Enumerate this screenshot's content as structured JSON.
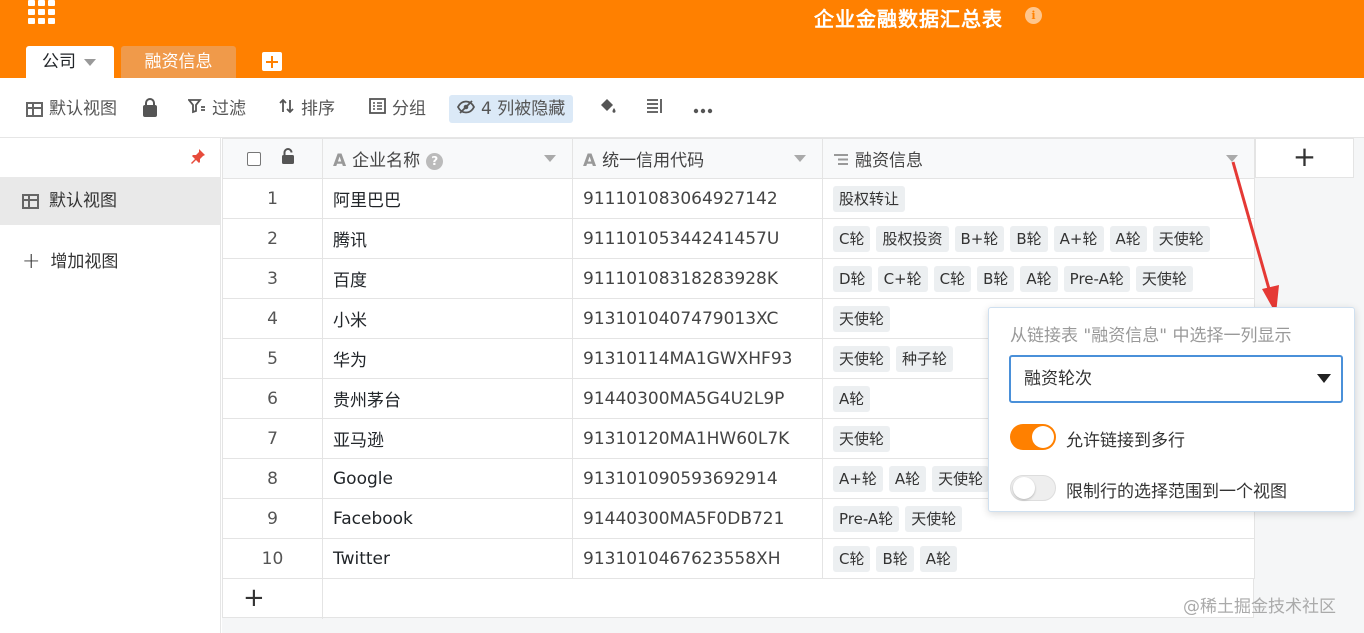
{
  "header": {
    "title": "企业金融数据汇总表",
    "tabs": [
      {
        "label": "公司"
      },
      {
        "label": "融资信息"
      }
    ]
  },
  "toolbar": {
    "view_label": "默认视图",
    "filter_label": "过滤",
    "sort_label": "排序",
    "group_label": "分组",
    "hidden_label": "4 列被隐藏"
  },
  "sidebar": {
    "items": [
      {
        "label": "默认视图"
      },
      {
        "label": "增加视图"
      }
    ]
  },
  "table": {
    "columns": [
      "企业名称",
      "统一信用代码",
      "融资信息"
    ],
    "rows": [
      {
        "num": "1",
        "name": "阿里巴巴",
        "code": "911101083064927142",
        "tags": [
          "股权转让"
        ]
      },
      {
        "num": "2",
        "name": "腾讯",
        "code": "91110105344241457U",
        "tags": [
          "C轮",
          "股权投资",
          "B+轮",
          "B轮",
          "A+轮",
          "A轮",
          "天使轮"
        ]
      },
      {
        "num": "3",
        "name": "百度",
        "code": "91110108318283928K",
        "tags": [
          "D轮",
          "C+轮",
          "C轮",
          "B轮",
          "A轮",
          "Pre-A轮",
          "天使轮"
        ]
      },
      {
        "num": "4",
        "name": "小米",
        "code": "9131010407479013XC",
        "tags": [
          "天使轮"
        ]
      },
      {
        "num": "5",
        "name": "华为",
        "code": "91310114MA1GWXHF93",
        "tags": [
          "天使轮",
          "种子轮"
        ]
      },
      {
        "num": "6",
        "name": "贵州茅台",
        "code": "91440300MA5G4U2L9P",
        "tags": [
          "A轮"
        ]
      },
      {
        "num": "7",
        "name": "亚马逊",
        "code": "91310120MA1HW60L7K",
        "tags": [
          "天使轮"
        ]
      },
      {
        "num": "8",
        "name": "Google",
        "code": "913101090593692914",
        "tags": [
          "A+轮",
          "A轮",
          "天使轮"
        ]
      },
      {
        "num": "9",
        "name": "Facebook",
        "code": "91440300MA5F0DB721",
        "tags": [
          "Pre-A轮",
          "天使轮"
        ]
      },
      {
        "num": "10",
        "name": "Twitter",
        "code": "9131010467623558XH",
        "tags": [
          "C轮",
          "B轮",
          "A轮"
        ]
      }
    ]
  },
  "popup": {
    "title": "从链接表 \"融资信息\" 中选择一列显示",
    "select_value": "融资轮次",
    "toggle1_label": "允许链接到多行",
    "toggle1_on": true,
    "toggle2_label": "限制行的选择范围到一个视图",
    "toggle2_on": false
  },
  "watermark": "@稀土掘金技术社区",
  "colors": {
    "brand": "#ff8000",
    "accent": "#4a90d9",
    "arrow": "#e53935"
  }
}
